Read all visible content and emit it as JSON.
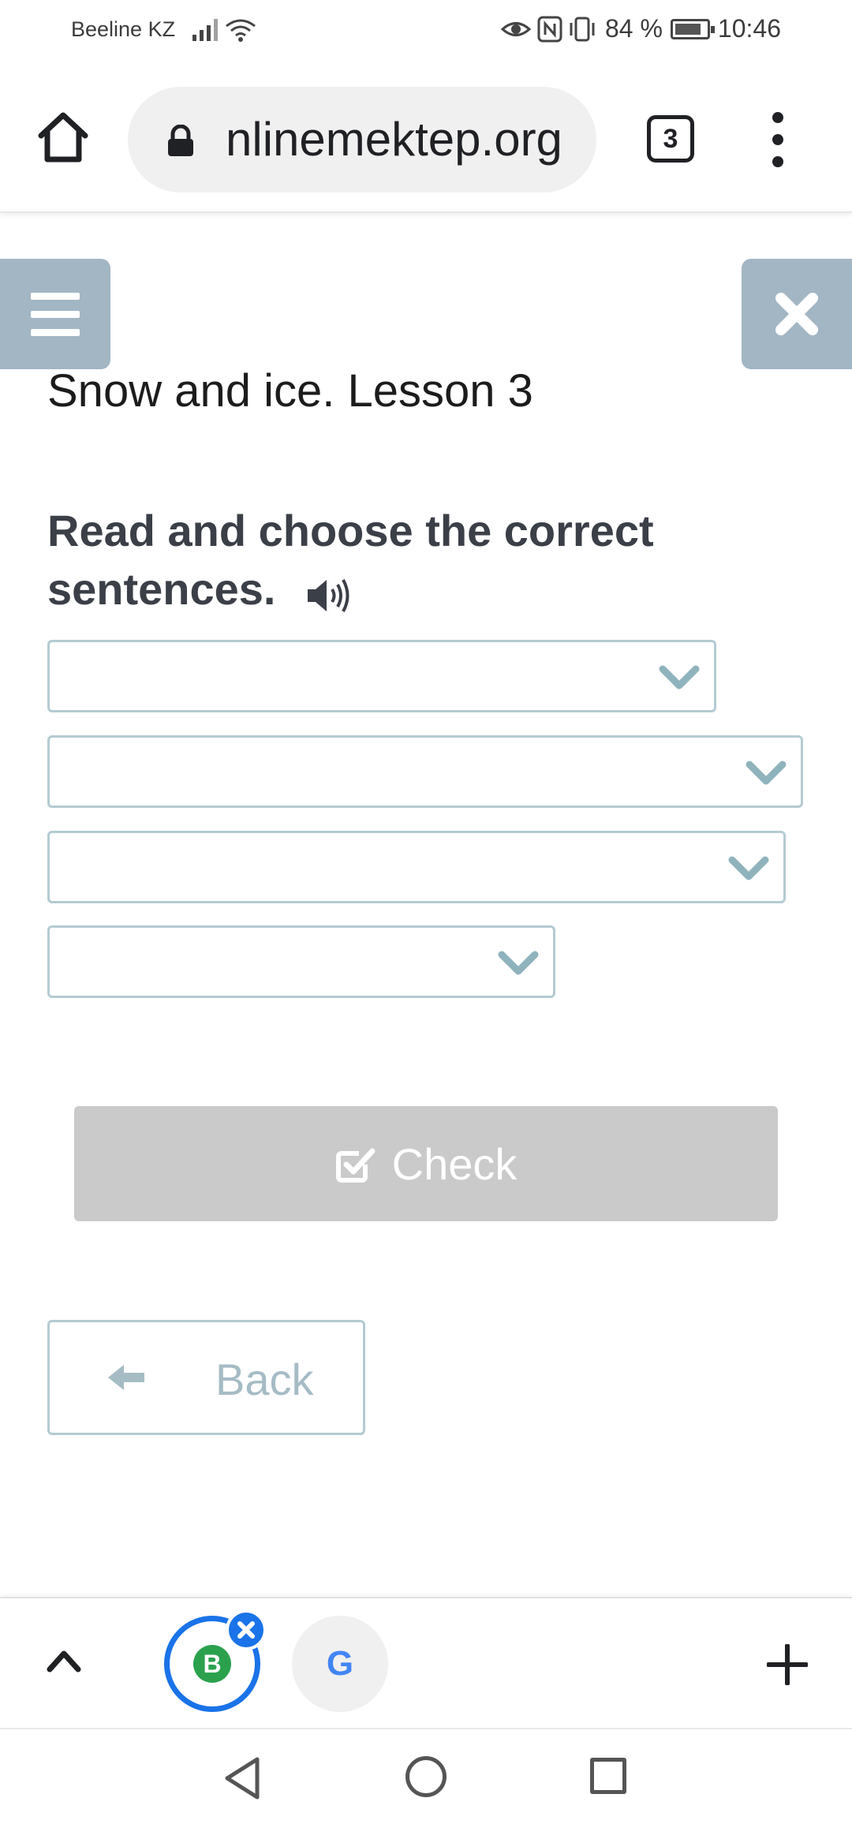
{
  "status_bar": {
    "carrier": "Beeline KZ",
    "battery_percent": "84 %",
    "battery_level": 0.84,
    "time": "10:46"
  },
  "browser": {
    "url": "nlinemektep.org",
    "tab_count": "3"
  },
  "page": {
    "lesson_title": "Snow and ice. Lesson 3",
    "task_title": "Read and choose the correct sentences.",
    "dropdowns": [
      "",
      "",
      "",
      ""
    ],
    "check_label": "Check",
    "back_label": "Back"
  },
  "colors": {
    "panel_button": "#a2b6c4",
    "select_border": "#b3cbd2",
    "chevron": "#8fb3bd",
    "check_disabled": "#cacaca",
    "back_text": "#a5bcc5",
    "tab_active_ring": "#1a73e8"
  },
  "icons": {
    "home": "home-icon",
    "lock": "lock-icon",
    "menu": "more-vert-icon",
    "hamburger": "hamburger-icon",
    "close": "close-icon",
    "speaker": "speaker-icon",
    "chevron": "chevron-down-icon",
    "check": "check-square-icon",
    "back": "arrow-left-icon"
  }
}
